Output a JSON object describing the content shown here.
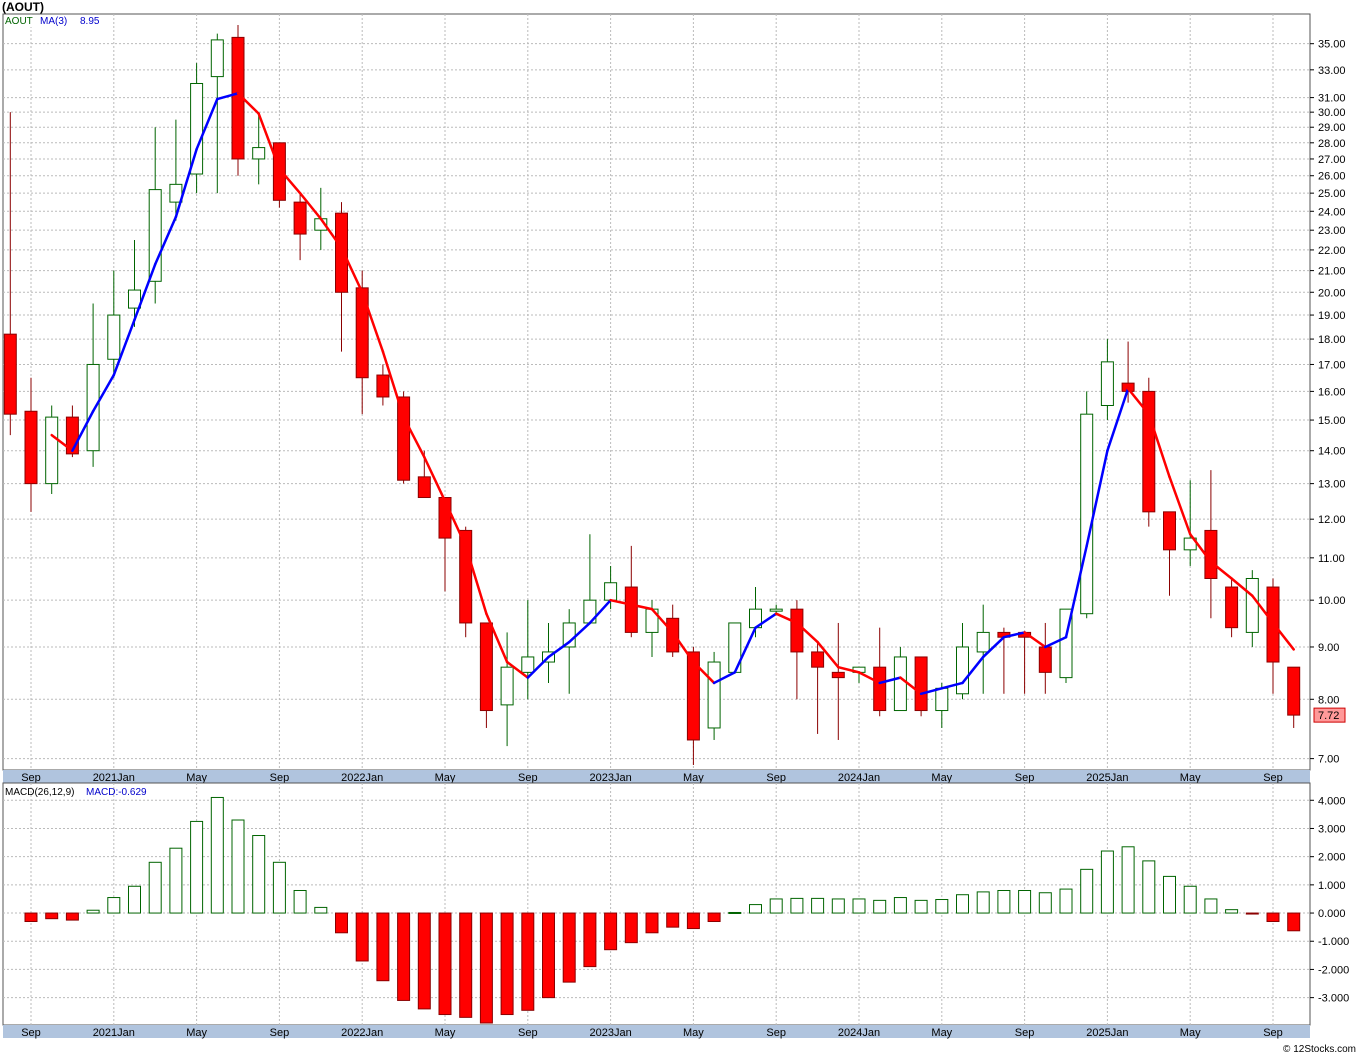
{
  "header": {
    "title": "(AOUT)",
    "legend_symbol": "AOUT",
    "legend_ma": "MA(3)",
    "legend_ma_value": "8.95",
    "macd_legend": "MACD(26,12,9)",
    "macd_value_label": "MACD:-0.629",
    "last_price_badge": "7.72",
    "credit": "© 12Stocks.com"
  },
  "colors": {
    "up_candle_fill": "#ffffff",
    "up_candle_border": "#006400",
    "down_candle_fill": "#ff0000",
    "down_candle_border": "#8b0000",
    "ma_up": "#0000ff",
    "ma_down": "#ff0000",
    "axis_band": "#b0c4de",
    "grid": "#bbbbbb",
    "badge_fill": "#ff9999"
  },
  "chart_data": [
    {
      "type": "candlestick",
      "title": "(AOUT)",
      "scale": "log",
      "ylim": [
        6.9,
        37.0
      ],
      "yticks": [
        "35.00",
        "33.00",
        "31.00",
        "30.00",
        "29.00",
        "28.00",
        "27.00",
        "26.00",
        "25.00",
        "24.00",
        "23.00",
        "22.00",
        "21.00",
        "20.00",
        "19.00",
        "18.00",
        "17.00",
        "16.00",
        "15.00",
        "14.00",
        "13.00",
        "12.00",
        "11.00",
        "10.00",
        "9.00",
        "8.00",
        "7.00"
      ],
      "x_labels": [
        "Sep",
        "2021Jan",
        "May",
        "Sep",
        "2022Jan",
        "May",
        "Sep",
        "2023Jan",
        "May",
        "Sep",
        "2024Jan",
        "May",
        "Sep",
        "2025Jan",
        "May",
        "Sep"
      ],
      "x_label_months": [
        8,
        12,
        16,
        20,
        24,
        28,
        32,
        36,
        40,
        44,
        48,
        52,
        56,
        60,
        64,
        68
      ],
      "grid": true,
      "candles": [
        {
          "m": 7.0,
          "o": 18.2,
          "h": 30.0,
          "l": 14.5,
          "c": 15.2
        },
        {
          "m": 8.0,
          "o": 15.3,
          "h": 16.5,
          "l": 12.2,
          "c": 13.0
        },
        {
          "m": 9.0,
          "o": 13.0,
          "h": 15.5,
          "l": 12.7,
          "c": 15.1
        },
        {
          "m": 10.0,
          "o": 15.1,
          "h": 15.5,
          "l": 13.8,
          "c": 13.9
        },
        {
          "m": 11.0,
          "o": 14.0,
          "h": 19.5,
          "l": 13.5,
          "c": 17.0
        },
        {
          "m": 12.0,
          "o": 17.2,
          "h": 21.0,
          "l": 16.5,
          "c": 19.0
        },
        {
          "m": 13.0,
          "o": 19.3,
          "h": 22.5,
          "l": 18.5,
          "c": 20.1
        },
        {
          "m": 14.0,
          "o": 20.5,
          "h": 29.0,
          "l": 19.5,
          "c": 25.2
        },
        {
          "m": 15.0,
          "o": 24.5,
          "h": 29.5,
          "l": 23.5,
          "c": 25.5
        },
        {
          "m": 16.0,
          "o": 26.1,
          "h": 33.5,
          "l": 25.0,
          "c": 32.0
        },
        {
          "m": 17.0,
          "o": 32.5,
          "h": 35.8,
          "l": 25.0,
          "c": 35.3
        },
        {
          "m": 18.0,
          "o": 35.5,
          "h": 36.5,
          "l": 26.0,
          "c": 27.0
        },
        {
          "m": 19.0,
          "o": 27.0,
          "h": 30.0,
          "l": 25.5,
          "c": 27.7
        },
        {
          "m": 20.0,
          "o": 28.0,
          "h": 28.0,
          "l": 24.2,
          "c": 24.6
        },
        {
          "m": 21.0,
          "o": 24.5,
          "h": 25.0,
          "l": 21.5,
          "c": 22.8
        },
        {
          "m": 22.0,
          "o": 23.0,
          "h": 25.3,
          "l": 22.0,
          "c": 23.6
        },
        {
          "m": 23.0,
          "o": 23.9,
          "h": 24.5,
          "l": 17.5,
          "c": 20.0
        },
        {
          "m": 24.0,
          "o": 20.2,
          "h": 21.0,
          "l": 15.2,
          "c": 16.5
        },
        {
          "m": 25.0,
          "o": 16.6,
          "h": 17.0,
          "l": 15.5,
          "c": 15.8
        },
        {
          "m": 26.0,
          "o": 15.8,
          "h": 16.0,
          "l": 13.0,
          "c": 13.1
        },
        {
          "m": 27.0,
          "o": 13.2,
          "h": 14.0,
          "l": 12.6,
          "c": 12.6
        },
        {
          "m": 28.0,
          "o": 12.6,
          "h": 12.6,
          "l": 10.2,
          "c": 11.5
        },
        {
          "m": 29.0,
          "o": 11.7,
          "h": 11.8,
          "l": 9.2,
          "c": 9.5
        },
        {
          "m": 30.0,
          "o": 9.5,
          "h": 9.5,
          "l": 7.5,
          "c": 7.8
        },
        {
          "m": 31.0,
          "o": 7.9,
          "h": 9.3,
          "l": 7.2,
          "c": 8.6
        },
        {
          "m": 32.0,
          "o": 8.5,
          "h": 10.0,
          "l": 8.0,
          "c": 8.8
        },
        {
          "m": 33.0,
          "o": 8.7,
          "h": 9.5,
          "l": 8.3,
          "c": 8.9
        },
        {
          "m": 34.0,
          "o": 9.0,
          "h": 9.8,
          "l": 8.1,
          "c": 9.5
        },
        {
          "m": 35.0,
          "o": 9.5,
          "h": 11.6,
          "l": 9.5,
          "c": 10.0
        },
        {
          "m": 36.0,
          "o": 10.0,
          "h": 10.8,
          "l": 9.8,
          "c": 10.4
        },
        {
          "m": 37.0,
          "o": 10.3,
          "h": 11.3,
          "l": 9.2,
          "c": 9.3
        },
        {
          "m": 38.0,
          "o": 9.3,
          "h": 10.0,
          "l": 8.8,
          "c": 9.8
        },
        {
          "m": 39.0,
          "o": 9.6,
          "h": 9.9,
          "l": 8.8,
          "c": 8.9
        },
        {
          "m": 40.0,
          "o": 8.9,
          "h": 9.0,
          "l": 6.9,
          "c": 7.3
        },
        {
          "m": 41.0,
          "o": 7.5,
          "h": 8.9,
          "l": 7.3,
          "c": 8.7
        },
        {
          "m": 42.0,
          "o": 8.5,
          "h": 9.5,
          "l": 8.5,
          "c": 9.5
        },
        {
          "m": 43.0,
          "o": 9.4,
          "h": 10.3,
          "l": 9.2,
          "c": 9.8
        },
        {
          "m": 44.0,
          "o": 9.8,
          "h": 9.9,
          "l": 9.7,
          "c": 9.8
        },
        {
          "m": 45.0,
          "o": 9.8,
          "h": 10.0,
          "l": 8.0,
          "c": 8.9
        },
        {
          "m": 46.0,
          "o": 8.9,
          "h": 9.1,
          "l": 7.4,
          "c": 8.6
        },
        {
          "m": 47.0,
          "o": 8.5,
          "h": 9.5,
          "l": 7.3,
          "c": 8.4
        },
        {
          "m": 48.0,
          "o": 8.5,
          "h": 8.6,
          "l": 8.3,
          "c": 8.6
        },
        {
          "m": 49.0,
          "o": 8.6,
          "h": 9.4,
          "l": 7.7,
          "c": 7.8
        },
        {
          "m": 50.0,
          "o": 7.8,
          "h": 9.0,
          "l": 7.8,
          "c": 8.8
        },
        {
          "m": 51.0,
          "o": 8.8,
          "h": 8.8,
          "l": 7.7,
          "c": 7.8
        },
        {
          "m": 52.0,
          "o": 7.8,
          "h": 8.3,
          "l": 7.5,
          "c": 8.2
        },
        {
          "m": 53.0,
          "o": 8.1,
          "h": 9.5,
          "l": 8.0,
          "c": 9.0
        },
        {
          "m": 54.0,
          "o": 8.9,
          "h": 9.9,
          "l": 8.1,
          "c": 9.3
        },
        {
          "m": 55.0,
          "o": 9.3,
          "h": 9.4,
          "l": 8.1,
          "c": 9.2
        },
        {
          "m": 56.0,
          "o": 9.3,
          "h": 9.3,
          "l": 8.1,
          "c": 9.2
        },
        {
          "m": 57.0,
          "o": 9.0,
          "h": 9.5,
          "l": 8.1,
          "c": 8.5
        },
        {
          "m": 58.0,
          "o": 8.4,
          "h": 9.8,
          "l": 8.3,
          "c": 9.8
        },
        {
          "m": 59.0,
          "o": 9.7,
          "h": 16.0,
          "l": 9.6,
          "c": 15.2
        },
        {
          "m": 60.0,
          "o": 15.5,
          "h": 18.0,
          "l": 15.0,
          "c": 17.1
        },
        {
          "m": 61.0,
          "o": 16.3,
          "h": 17.9,
          "l": 15.6,
          "c": 16.0
        },
        {
          "m": 62.0,
          "o": 16.0,
          "h": 16.5,
          "l": 11.8,
          "c": 12.2
        },
        {
          "m": 63.0,
          "o": 12.2,
          "h": 12.2,
          "l": 10.1,
          "c": 11.2
        },
        {
          "m": 64.0,
          "o": 11.2,
          "h": 13.1,
          "l": 10.8,
          "c": 11.5
        },
        {
          "m": 65.0,
          "o": 11.7,
          "h": 13.4,
          "l": 9.6,
          "c": 10.5
        },
        {
          "m": 66.0,
          "o": 10.3,
          "h": 10.5,
          "l": 9.2,
          "c": 9.4
        },
        {
          "m": 67.0,
          "o": 9.3,
          "h": 10.7,
          "l": 9.0,
          "c": 10.5
        },
        {
          "m": 68.0,
          "o": 10.3,
          "h": 10.5,
          "l": 8.1,
          "c": 8.7
        },
        {
          "m": 69.0,
          "o": 8.6,
          "h": 8.6,
          "l": 7.5,
          "c": 7.72
        }
      ],
      "moving_average": {
        "name": "MA(3)",
        "last_value": 8.95,
        "points": [
          {
            "m": 9.0,
            "v": 14.5
          },
          {
            "m": 10.0,
            "v": 14.0
          },
          {
            "m": 11.0,
            "v": 15.3
          },
          {
            "m": 12.0,
            "v": 16.6
          },
          {
            "m": 13.0,
            "v": 18.8
          },
          {
            "m": 14.0,
            "v": 21.3
          },
          {
            "m": 15.0,
            "v": 23.7
          },
          {
            "m": 16.0,
            "v": 27.6
          },
          {
            "m": 17.0,
            "v": 30.9
          },
          {
            "m": 18.0,
            "v": 31.3
          },
          {
            "m": 19.0,
            "v": 29.9
          },
          {
            "m": 20.0,
            "v": 26.4
          },
          {
            "m": 21.0,
            "v": 25.0
          },
          {
            "m": 22.0,
            "v": 23.6
          },
          {
            "m": 23.0,
            "v": 22.1
          },
          {
            "m": 24.0,
            "v": 20.0
          },
          {
            "m": 25.0,
            "v": 17.5
          },
          {
            "m": 26.0,
            "v": 15.1
          },
          {
            "m": 27.0,
            "v": 13.8
          },
          {
            "m": 28.0,
            "v": 12.5
          },
          {
            "m": 29.0,
            "v": 11.3
          },
          {
            "m": 30.0,
            "v": 9.7
          },
          {
            "m": 31.0,
            "v": 8.7
          },
          {
            "m": 32.0,
            "v": 8.4
          },
          {
            "m": 33.0,
            "v": 8.8
          },
          {
            "m": 34.0,
            "v": 9.1
          },
          {
            "m": 35.0,
            "v": 9.5
          },
          {
            "m": 36.0,
            "v": 10.0
          },
          {
            "m": 37.0,
            "v": 9.9
          },
          {
            "m": 38.0,
            "v": 9.8
          },
          {
            "m": 39.0,
            "v": 9.3
          },
          {
            "m": 40.0,
            "v": 8.7
          },
          {
            "m": 41.0,
            "v": 8.3
          },
          {
            "m": 42.0,
            "v": 8.5
          },
          {
            "m": 43.0,
            "v": 9.4
          },
          {
            "m": 44.0,
            "v": 9.7
          },
          {
            "m": 45.0,
            "v": 9.5
          },
          {
            "m": 46.0,
            "v": 9.1
          },
          {
            "m": 47.0,
            "v": 8.6
          },
          {
            "m": 48.0,
            "v": 8.5
          },
          {
            "m": 49.0,
            "v": 8.3
          },
          {
            "m": 50.0,
            "v": 8.4
          },
          {
            "m": 51.0,
            "v": 8.1
          },
          {
            "m": 52.0,
            "v": 8.2
          },
          {
            "m": 53.0,
            "v": 8.3
          },
          {
            "m": 54.0,
            "v": 8.8
          },
          {
            "m": 55.0,
            "v": 9.2
          },
          {
            "m": 56.0,
            "v": 9.3
          },
          {
            "m": 57.0,
            "v": 9.0
          },
          {
            "m": 58.0,
            "v": 9.2
          },
          {
            "m": 59.0,
            "v": 11.3
          },
          {
            "m": 60.0,
            "v": 14.0
          },
          {
            "m": 61.0,
            "v": 16.1
          },
          {
            "m": 62.0,
            "v": 15.2
          },
          {
            "m": 63.0,
            "v": 13.2
          },
          {
            "m": 64.0,
            "v": 11.6
          },
          {
            "m": 65.0,
            "v": 10.9
          },
          {
            "m": 66.0,
            "v": 10.5
          },
          {
            "m": 67.0,
            "v": 10.1
          },
          {
            "m": 68.0,
            "v": 9.5
          },
          {
            "m": 69.0,
            "v": 8.95
          }
        ]
      }
    },
    {
      "type": "bar",
      "title": "MACD(26,12,9)",
      "ylim": [
        -3.9,
        4.4
      ],
      "yticks": [
        "4.000",
        "3.000",
        "2.000",
        "1.000",
        "0.000",
        "-1.000",
        "-2.000",
        "-3.000"
      ],
      "ytick_values": [
        4,
        3,
        2,
        1,
        0,
        -1,
        -2,
        -3
      ],
      "last_value": -0.629,
      "bars": [
        {
          "m": 8.0,
          "v": -0.3
        },
        {
          "m": 9.0,
          "v": -0.2
        },
        {
          "m": 10.0,
          "v": -0.25
        },
        {
          "m": 11.0,
          "v": 0.1
        },
        {
          "m": 12.0,
          "v": 0.55
        },
        {
          "m": 13.0,
          "v": 0.95
        },
        {
          "m": 14.0,
          "v": 1.8
        },
        {
          "m": 15.0,
          "v": 2.3
        },
        {
          "m": 16.0,
          "v": 3.25
        },
        {
          "m": 17.0,
          "v": 4.1
        },
        {
          "m": 18.0,
          "v": 3.3
        },
        {
          "m": 19.0,
          "v": 2.75
        },
        {
          "m": 20.0,
          "v": 1.8
        },
        {
          "m": 21.0,
          "v": 0.8
        },
        {
          "m": 22.0,
          "v": 0.2
        },
        {
          "m": 23.0,
          "v": -0.7
        },
        {
          "m": 24.0,
          "v": -1.7
        },
        {
          "m": 25.0,
          "v": -2.4
        },
        {
          "m": 26.0,
          "v": -3.1
        },
        {
          "m": 27.0,
          "v": -3.4
        },
        {
          "m": 28.0,
          "v": -3.6
        },
        {
          "m": 29.0,
          "v": -3.7
        },
        {
          "m": 30.0,
          "v": -3.9
        },
        {
          "m": 31.0,
          "v": -3.6
        },
        {
          "m": 32.0,
          "v": -3.45
        },
        {
          "m": 33.0,
          "v": -3.0
        },
        {
          "m": 34.0,
          "v": -2.45
        },
        {
          "m": 35.0,
          "v": -1.9
        },
        {
          "m": 36.0,
          "v": -1.3
        },
        {
          "m": 37.0,
          "v": -1.05
        },
        {
          "m": 38.0,
          "v": -0.7
        },
        {
          "m": 39.0,
          "v": -0.5
        },
        {
          "m": 40.0,
          "v": -0.55
        },
        {
          "m": 41.0,
          "v": -0.3
        },
        {
          "m": 42.0,
          "v": 0.02
        },
        {
          "m": 43.0,
          "v": 0.3
        },
        {
          "m": 44.0,
          "v": 0.5
        },
        {
          "m": 45.0,
          "v": 0.52
        },
        {
          "m": 46.0,
          "v": 0.52
        },
        {
          "m": 47.0,
          "v": 0.5
        },
        {
          "m": 48.0,
          "v": 0.5
        },
        {
          "m": 49.0,
          "v": 0.45
        },
        {
          "m": 50.0,
          "v": 0.55
        },
        {
          "m": 51.0,
          "v": 0.45
        },
        {
          "m": 52.0,
          "v": 0.48
        },
        {
          "m": 53.0,
          "v": 0.65
        },
        {
          "m": 54.0,
          "v": 0.75
        },
        {
          "m": 55.0,
          "v": 0.8
        },
        {
          "m": 56.0,
          "v": 0.8
        },
        {
          "m": 57.0,
          "v": 0.72
        },
        {
          "m": 58.0,
          "v": 0.85
        },
        {
          "m": 59.0,
          "v": 1.55
        },
        {
          "m": 60.0,
          "v": 2.2
        },
        {
          "m": 61.0,
          "v": 2.35
        },
        {
          "m": 62.0,
          "v": 1.85
        },
        {
          "m": 63.0,
          "v": 1.3
        },
        {
          "m": 64.0,
          "v": 0.95
        },
        {
          "m": 65.0,
          "v": 0.5
        },
        {
          "m": 66.0,
          "v": 0.12
        },
        {
          "m": 67.0,
          "v": -0.02
        },
        {
          "m": 68.0,
          "v": -0.3
        },
        {
          "m": 69.0,
          "v": -0.629
        }
      ]
    }
  ]
}
